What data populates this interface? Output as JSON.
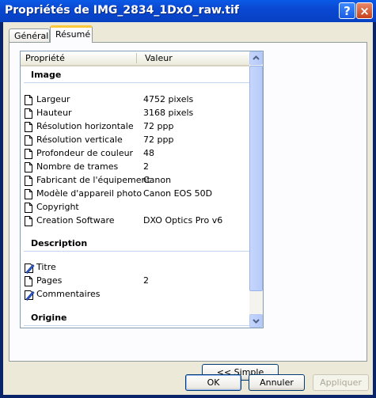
{
  "window": {
    "title": "Propriétés de IMG_2834_1DxO_raw.tif"
  },
  "tabs": [
    {
      "label": "Général"
    },
    {
      "label": "Résumé"
    }
  ],
  "columns": {
    "property": "Propriété",
    "value": "Valeur"
  },
  "groups": {
    "image": {
      "label": "Image",
      "rows": [
        {
          "name": "Largeur",
          "value": "4752 pixels"
        },
        {
          "name": "Hauteur",
          "value": "3168 pixels"
        },
        {
          "name": "Résolution horizontale",
          "value": "72 ppp"
        },
        {
          "name": "Résolution verticale",
          "value": "72 ppp"
        },
        {
          "name": "Profondeur de couleur",
          "value": "48"
        },
        {
          "name": "Nombre de trames",
          "value": "2"
        },
        {
          "name": "Fabricant de l'équipement",
          "value": "Canon"
        },
        {
          "name": "Modèle d'appareil photo",
          "value": "Canon EOS 50D"
        },
        {
          "name": "Copyright",
          "value": ""
        },
        {
          "name": "Creation Software",
          "value": "DXO Optics Pro v6"
        }
      ]
    },
    "description": {
      "label": "Description",
      "rows": [
        {
          "name": "Titre",
          "value": "",
          "icon": "edit-icon"
        },
        {
          "name": "Pages",
          "value": "2",
          "icon": "document-icon"
        },
        {
          "name": "Commentaires",
          "value": "",
          "icon": "edit-icon"
        }
      ]
    },
    "origine": {
      "label": "Origine"
    }
  },
  "buttons": {
    "simple": "<< Simple",
    "ok": "OK",
    "cancel": "Annuler",
    "apply": "Appliquer"
  },
  "titlebar_buttons": {
    "help": "?",
    "close": "×"
  }
}
